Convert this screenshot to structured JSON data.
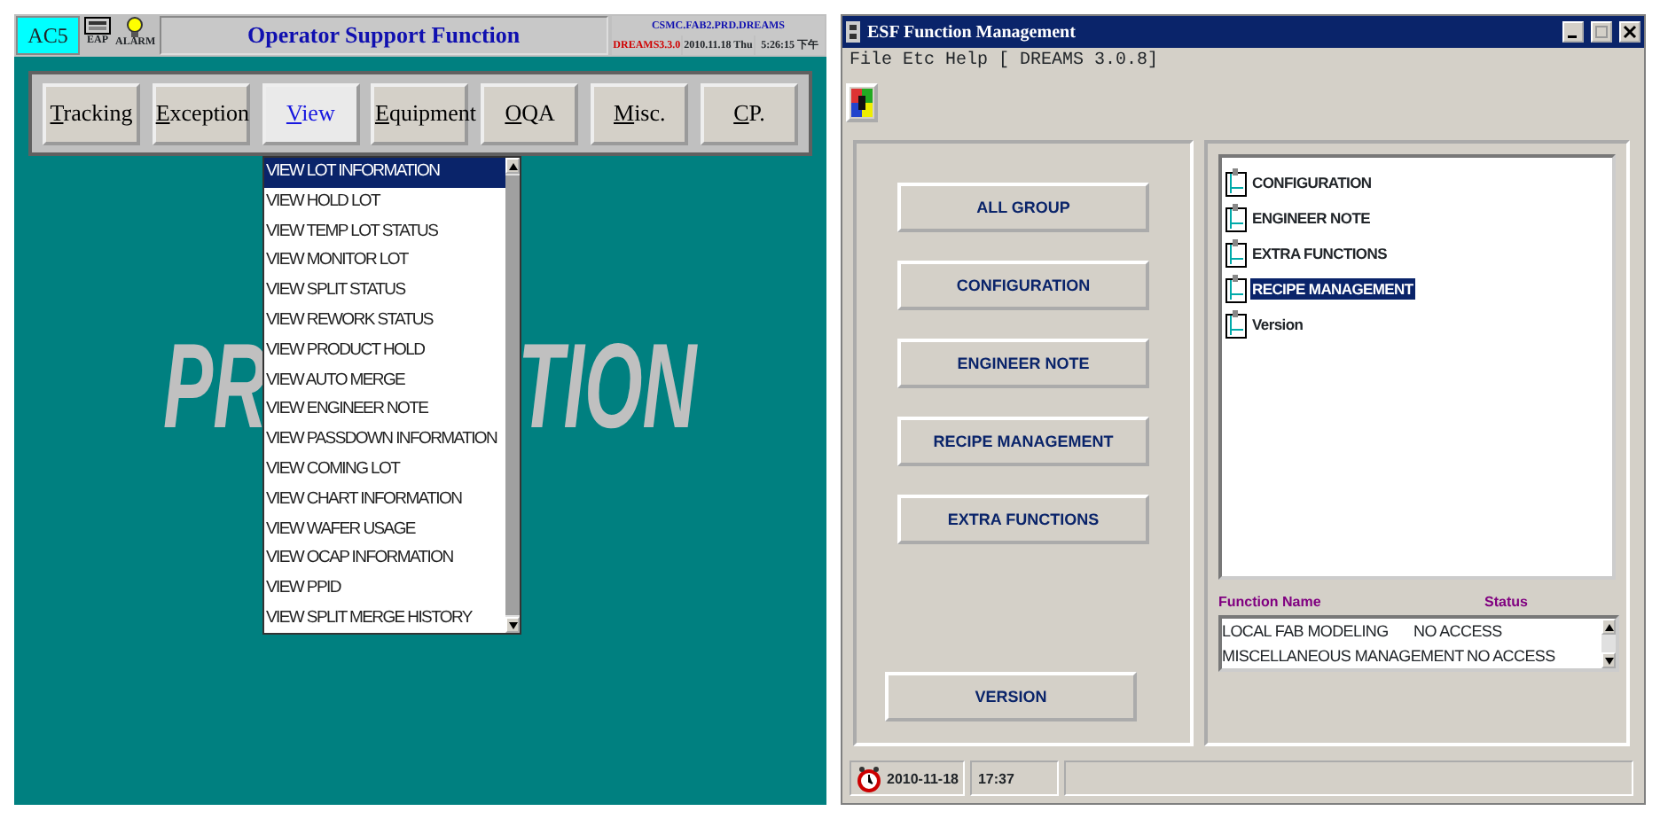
{
  "osf": {
    "station": "AC5",
    "eap_label": "EAP",
    "alarm_label": "ALARM",
    "title": "Operator Support Function",
    "server": "CSMC.FAB2.PRD.DREAMS",
    "version": "DREAMS3.3.0",
    "date": "2010.11.18 Thu",
    "time": "5:26:15 下午",
    "tabs": [
      {
        "label": "Tracking",
        "selected": false
      },
      {
        "label": "Exception",
        "selected": false
      },
      {
        "label": "View",
        "selected": true
      },
      {
        "label": "Equipment",
        "selected": false
      },
      {
        "label": "OQA",
        "selected": false
      },
      {
        "label": "Misc.",
        "selected": false
      },
      {
        "label": "CP.",
        "selected": false
      }
    ],
    "background_text": [
      "PR",
      "TION"
    ],
    "menu_items": [
      {
        "label": "VIEW LOT INFORMATION",
        "selected": true
      },
      {
        "label": "VIEW HOLD LOT",
        "selected": false
      },
      {
        "label": "VIEW TEMP LOT STATUS",
        "selected": false
      },
      {
        "label": "VIEW MONITOR LOT",
        "selected": false
      },
      {
        "label": "VIEW SPLIT STATUS",
        "selected": false
      },
      {
        "label": "VIEW REWORK STATUS",
        "selected": false
      },
      {
        "label": "VIEW PRODUCT HOLD",
        "selected": false
      },
      {
        "label": "VIEW AUTO MERGE",
        "selected": false
      },
      {
        "label": "VIEW ENGINEER NOTE",
        "selected": false
      },
      {
        "label": "VIEW PASSDOWN INFORMATION",
        "selected": false
      },
      {
        "label": "VIEW COMING LOT",
        "selected": false
      },
      {
        "label": "VIEW CHART INFORMATION",
        "selected": false
      },
      {
        "label": "VIEW WAFER USAGE",
        "selected": false
      },
      {
        "label": "VIEW OCAP INFORMATION",
        "selected": false
      },
      {
        "label": "VIEW PPID",
        "selected": false
      },
      {
        "label": "VIEW SPLIT MERGE HISTORY",
        "selected": false
      }
    ]
  },
  "esf": {
    "window": {
      "title": "ESF Function Management"
    },
    "menu": [
      "File",
      "Etc",
      "Help"
    ],
    "version": "[ DREAMS 3.0.8]",
    "buttons": [
      "ALL GROUP",
      "CONFIGURATION",
      "ENGINEER NOTE",
      "RECIPE MANAGEMENT",
      "EXTRA FUNCTIONS"
    ],
    "version_button": "VERSION",
    "tree": [
      {
        "label": "CONFIGURATION",
        "selected": false
      },
      {
        "label": "ENGINEER NOTE",
        "selected": false
      },
      {
        "label": "EXTRA FUNCTIONS",
        "selected": false
      },
      {
        "label": "RECIPE MANAGEMENT",
        "selected": true
      },
      {
        "label": "Version",
        "selected": false
      }
    ],
    "table": {
      "columns": [
        "Function Name",
        "Status"
      ],
      "rows": [
        [
          "LOCAL FAB MODELING",
          "NO ACCESS"
        ],
        [
          "MISCELLANEOUS MANAGEMENT",
          "NO ACCESS"
        ]
      ]
    },
    "status_bar": {
      "date": "2010-11-18",
      "time": "17:37"
    }
  }
}
